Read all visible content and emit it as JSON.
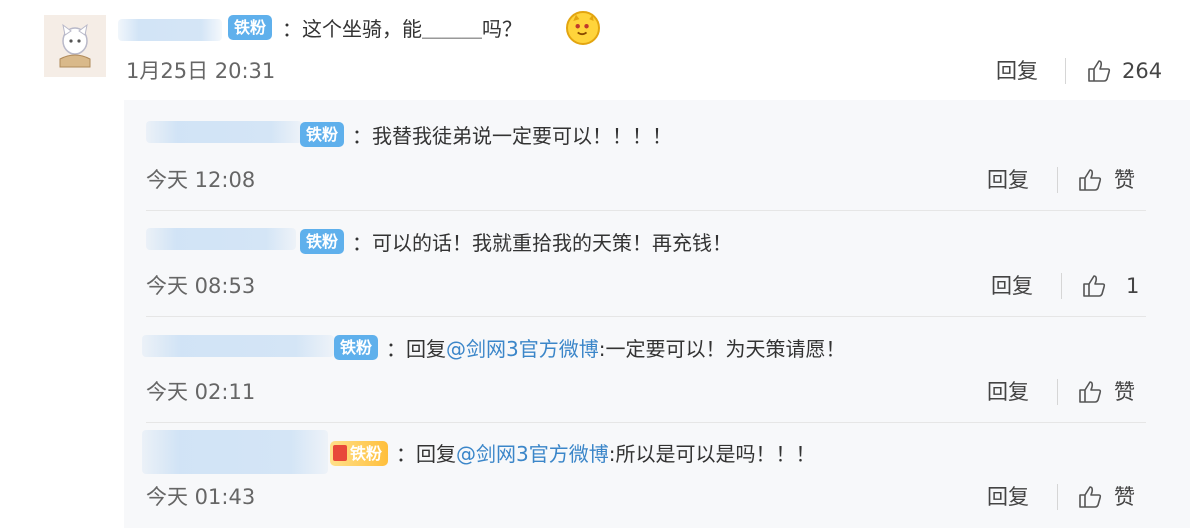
{
  "main_comment": {
    "badge": "铁粉",
    "text": "：这个坐骑，能＿＿＿吗？",
    "time": "1月25日 20:31",
    "reply_label": "回复",
    "like_count": "264",
    "emoji_icon": "cat-face-emoji-icon"
  },
  "replies": [
    {
      "badge": "铁粉",
      "text": "：我替我徒弟说一定要可以！！！！",
      "time": "今天 12:08",
      "reply_label": "回复",
      "like_label": "赞"
    },
    {
      "badge": "铁粉",
      "text": "：可以的话！我就重拾我的天策！再充钱！",
      "time": "今天 08:53",
      "reply_label": "回复",
      "like_label": "1"
    },
    {
      "badge": "铁粉",
      "prefix": "：回复",
      "mention": "@剑网3官方微博",
      "text": ":一定要可以！为天策请愿！",
      "time": "今天 02:11",
      "reply_label": "回复",
      "like_label": "赞"
    },
    {
      "badge": "铁粉",
      "prefix": "：回复",
      "mention": "@剑网3官方微博",
      "text": ":所以是可以是吗！！！",
      "time": "今天 01:43",
      "reply_label": "回复",
      "like_label": "赞"
    }
  ],
  "colors": {
    "badge_blue": "#5fb0ec",
    "mention_blue": "#3b86c9",
    "panel_bg": "#f7f8fa"
  }
}
